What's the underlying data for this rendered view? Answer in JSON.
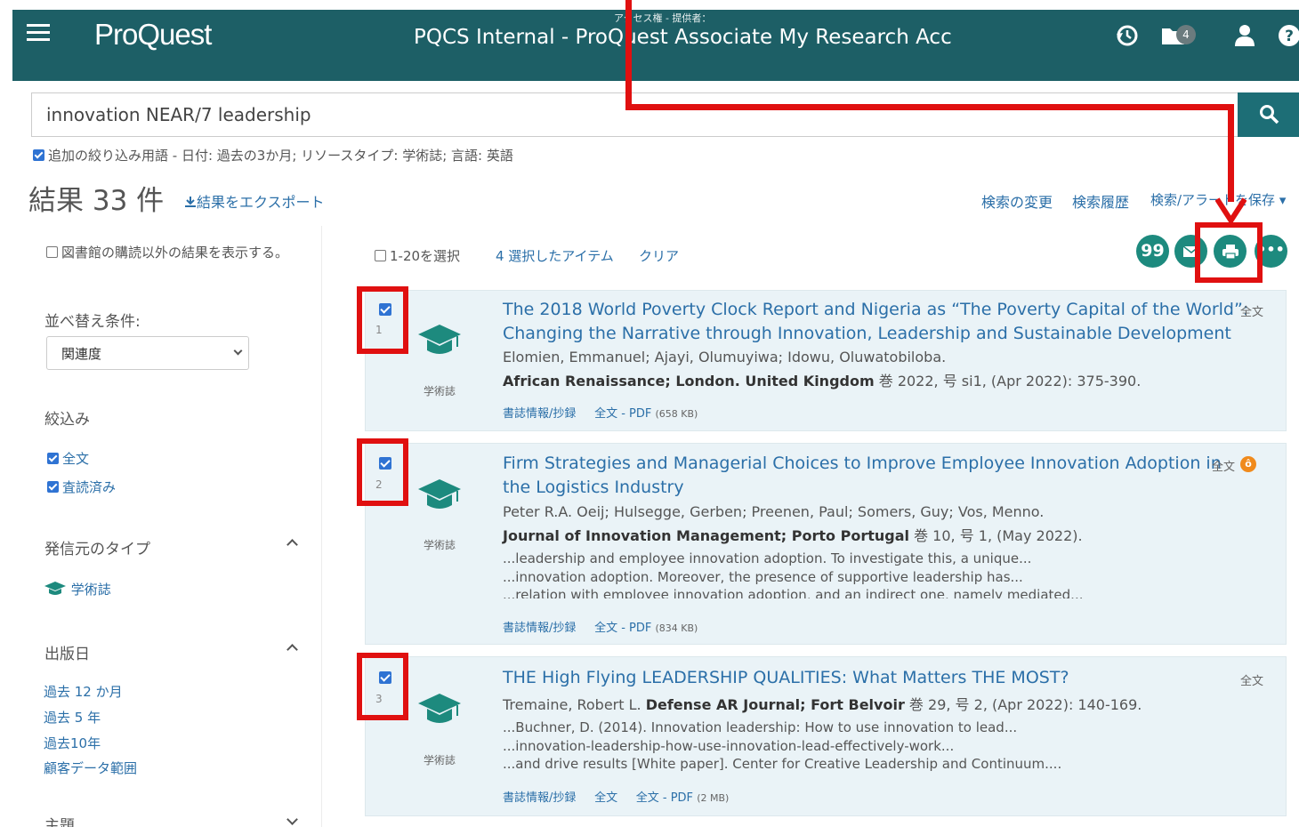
{
  "header": {
    "logo": "ProQuest",
    "access_label": "アクセス権 - 提供者：",
    "account_name": "PQCS Internal - ProQuest Associate My Research Acc",
    "folder_count": "4"
  },
  "search": {
    "query": "innovation NEAR/7 leadership",
    "additional_limits": "追加の絞り込み用語 - 日付: 過去の3か月; リソースタイプ: 学術誌; 言語: 英語"
  },
  "results_header": {
    "count": "結果 33 件",
    "export": "結果をエクスポート",
    "modify_search": "検索の変更",
    "search_history": "検索履歴",
    "save_search": "検索/アラートを保存 ▾"
  },
  "sidebar": {
    "show_non_subscribed": "図書館の購読以外の結果を表示する。",
    "sort_label": "並べ替え条件:",
    "sort_value": "関連度",
    "narrow_label": "絞込み",
    "filters": [
      "全文",
      "査読済み"
    ],
    "source_type_label": "発信元のタイプ",
    "source_type_item": "学術誌",
    "pub_date_label": "出版日",
    "date_options": [
      "過去 12 か月",
      "過去 5 年",
      "過去10年",
      "顧客データ範囲"
    ],
    "subject_label": "主題"
  },
  "toolbar": {
    "select_range": "1-20を選択",
    "selected_items": "4 選択したアイテム",
    "clear": "クリア",
    "cite_icon": "99"
  },
  "results": [
    {
      "num": "1",
      "type": "学術誌",
      "title_line1": "The 2018 World Poverty Clock Report and Nigeria as “The Poverty Capital of the World”:",
      "title_line2": "Changing the Narrative through Innovation, Leadership and Sustainable Development",
      "authors": "Elomien, Emmanuel; Ajayi, Olumuyiwa; Idowu, Oluwatobiloba.",
      "source_bold": "African Renaissance; London. United Kingdom",
      "source_rest": " 巻 2022, 号 si1,  (Apr 2022): 375-390.",
      "fulltext_badge": "全文",
      "link_abstract": "書誌情報/抄録",
      "link_pdf": "全文 - PDF",
      "pdf_size": "(658 KB)"
    },
    {
      "num": "2",
      "type": "学術誌",
      "title_line1": "Firm Strategies and Managerial Choices to Improve Employee Innovation Adoption in",
      "title_line2": "the Logistics Industry",
      "authors": "Peter R.A. Oeij; Hulsegge, Gerben; Preenen, Paul; Somers, Guy; Vos, Menno.",
      "source_bold": "Journal of Innovation Management; Porto Portugal",
      "source_rest": " 巻 10, 号 1,  (May 2022).",
      "fulltext_badge": "全文",
      "snippets": [
        "...leadership and employee innovation adoption. To investigate this, a unique...",
        "...innovation adoption. Moreover, the presence of supportive leadership has...",
        "...relation with employee innovation adoption, and an indirect one, namely mediated..."
      ],
      "link_abstract": "書誌情報/抄録",
      "link_pdf": "全文 - PDF",
      "pdf_size": "(834 KB)"
    },
    {
      "num": "3",
      "type": "学術誌",
      "title_line1": "THE High Flying LEADERSHIP QUALITIES: What Matters THE MOST?",
      "authors": "Tremaine, Robert L.",
      "source_bold": "Defense AR Journal; Fort Belvoir",
      "source_rest": " 巻 29, 号 2,  (Apr 2022): 140-169.",
      "fulltext_badge": "全文",
      "snippets": [
        "...Buchner, D. (2014). Innovation leadership: How to use innovation to lead...",
        "...innovation-leadership-how-use-innovation-lead-effectively-work...",
        "...and drive results [White paper]. Center for Creative Leadership and Continuum...."
      ],
      "link_abstract": "書誌情報/抄録",
      "link_fulltext": "全文",
      "link_pdf": "全文 - PDF",
      "pdf_size": "(2 MB)"
    }
  ]
}
